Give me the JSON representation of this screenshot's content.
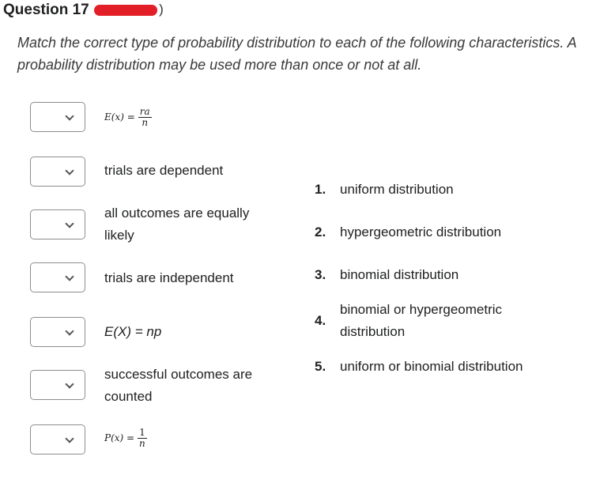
{
  "question": {
    "title": "Question 17",
    "points_redacted": true,
    "prompt": "Match the correct type of probability distribution to each of the following characteristics. A probability distribution may be used more than once or not at all."
  },
  "items": [
    {
      "type": "formula",
      "lhs": "E(x) =",
      "numerator": "ra",
      "denominator": "n",
      "selected": ""
    },
    {
      "type": "text",
      "text": "trials are dependent",
      "selected": ""
    },
    {
      "type": "text",
      "text": "all outcomes are equally likely",
      "selected": ""
    },
    {
      "type": "text",
      "text": "trials are independent",
      "selected": ""
    },
    {
      "type": "text",
      "text": "E(X) = np",
      "selected": ""
    },
    {
      "type": "text",
      "text": "successful outcomes are counted",
      "selected": ""
    },
    {
      "type": "formula",
      "lhs": "P(x) =",
      "numerator": "1",
      "denominator": "n",
      "selected": ""
    }
  ],
  "answers": [
    {
      "number": "1.",
      "text": "uniform distribution"
    },
    {
      "number": "2.",
      "text": "hypergeometric distribution"
    },
    {
      "number": "3.",
      "text": "binomial distribution"
    },
    {
      "number": "4.",
      "text": "binomial or hypergeometric distribution"
    },
    {
      "number": "5.",
      "text": "uniform or binomial distribution"
    }
  ],
  "colors": {
    "redaction": "#e21f26",
    "border": "#8a8d91"
  }
}
